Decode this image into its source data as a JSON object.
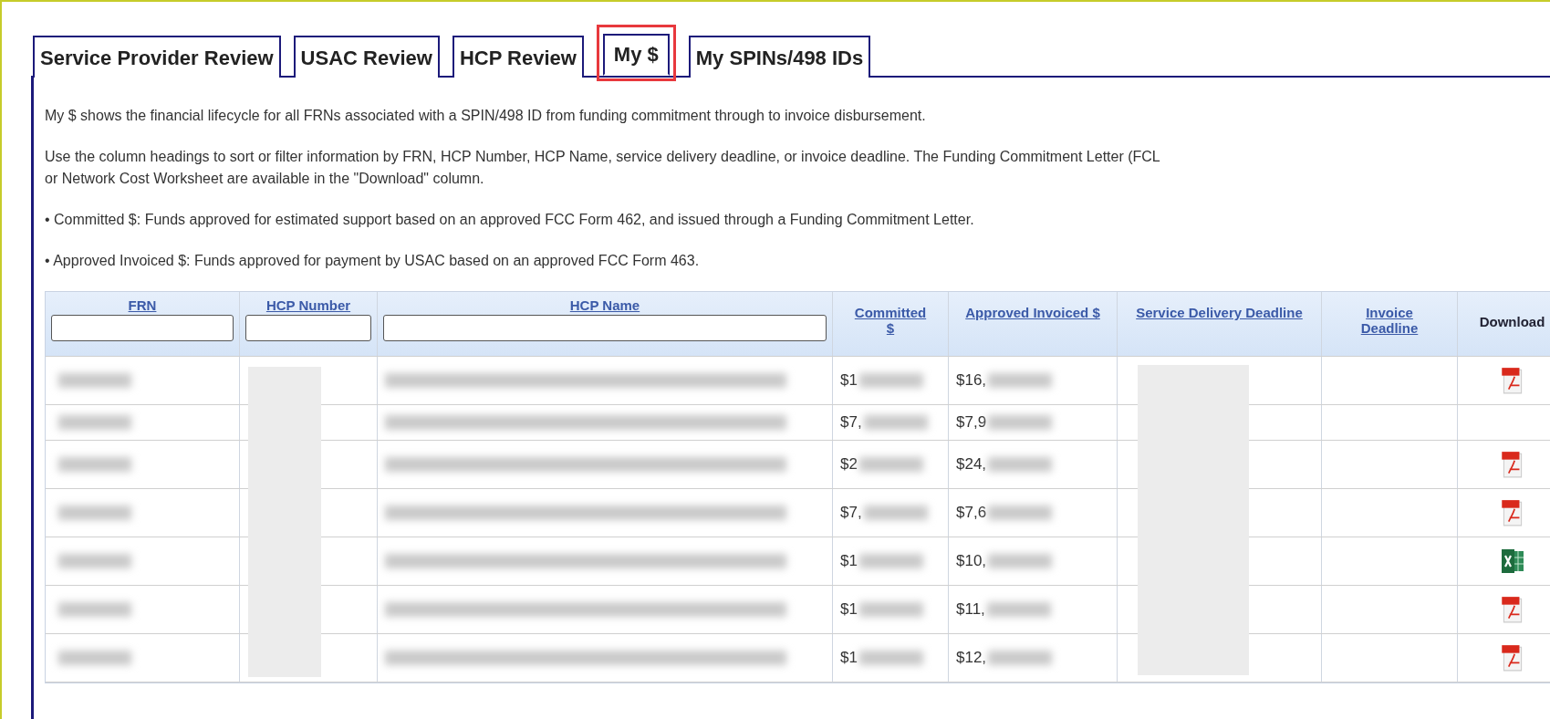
{
  "tabs": [
    {
      "label": "Service Provider Review",
      "selected": false
    },
    {
      "label": "USAC Review",
      "selected": false
    },
    {
      "label": "HCP Review",
      "selected": false
    },
    {
      "label": "My $",
      "selected": true
    },
    {
      "label": "My SPINs/498 IDs",
      "selected": false
    }
  ],
  "intro": [
    {
      "lines": [
        "My $ shows the financial lifecycle for all FRNs associated with a SPIN/498 ID from funding commitment through to invoice disbursement."
      ]
    },
    {
      "lines": [
        "Use the column headings to sort or filter information by FRN, HCP Number, HCP Name, service delivery deadline, or invoice deadline. The Funding Commitment Letter (FCL",
        "or Network Cost Worksheet are available in the \"Download\" column."
      ]
    },
    {
      "lines": [
        "• Committed $: Funds approved for estimated support based on an approved FCC Form 462, and issued through a Funding Commitment Letter."
      ]
    },
    {
      "lines": [
        "• Approved Invoiced $: Funds approved for payment by USAC based on an approved FCC Form 463."
      ]
    }
  ],
  "table": {
    "columns": [
      {
        "label": "FRN",
        "kind": "sort_filter"
      },
      {
        "label": "HCP Number",
        "kind": "sort_filter"
      },
      {
        "label": "HCP Name",
        "kind": "sort_filter"
      },
      {
        "label": "Committed $",
        "kind": "sort"
      },
      {
        "label": "Approved Invoiced $",
        "kind": "sort"
      },
      {
        "label": "Service Delivery Deadline",
        "kind": "sort"
      },
      {
        "label": "Invoice Deadline",
        "kind": "sort"
      },
      {
        "label": "Download",
        "kind": "plain"
      }
    ],
    "rows": [
      {
        "committed": "$1",
        "approved": "$16,",
        "kind": "pdf"
      },
      {
        "committed": "$7,",
        "approved": "$7,9",
        "kind": "none"
      },
      {
        "committed": "$2",
        "approved": "$24,",
        "kind": "pdf"
      },
      {
        "committed": "$7,",
        "approved": "$7,6",
        "kind": "pdf"
      },
      {
        "committed": "$1",
        "approved": "$10,",
        "kind": "excel"
      },
      {
        "committed": "$1",
        "approved": "$11,",
        "kind": "pdf"
      },
      {
        "committed": "$1",
        "approved": "$12,",
        "kind": "pdf"
      }
    ]
  }
}
